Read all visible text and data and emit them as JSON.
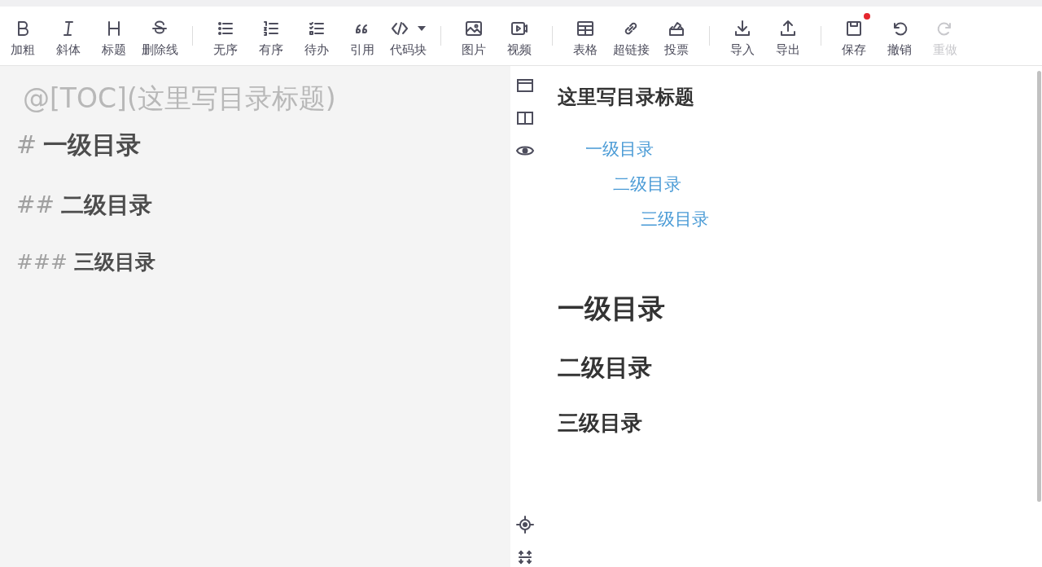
{
  "toolbar": {
    "groups": [
      [
        {
          "kind": "bold",
          "label": "加粗",
          "disabled": false,
          "badge": false
        },
        {
          "kind": "italic",
          "label": "斜体",
          "disabled": false,
          "badge": false
        },
        {
          "kind": "heading",
          "label": "标题",
          "disabled": false,
          "badge": false
        },
        {
          "kind": "strike",
          "label": "删除线",
          "disabled": false,
          "badge": false
        }
      ],
      [
        {
          "kind": "ul",
          "label": "无序",
          "disabled": false,
          "badge": false
        },
        {
          "kind": "ol",
          "label": "有序",
          "disabled": false,
          "badge": false
        },
        {
          "kind": "todo",
          "label": "待办",
          "disabled": false,
          "badge": false
        },
        {
          "kind": "quote",
          "label": "引用",
          "disabled": false,
          "badge": false
        },
        {
          "kind": "code",
          "label": "代码块",
          "disabled": false,
          "badge": false
        }
      ],
      [
        {
          "kind": "image",
          "label": "图片",
          "disabled": false,
          "badge": false
        },
        {
          "kind": "video",
          "label": "视频",
          "disabled": false,
          "badge": false
        }
      ],
      [
        {
          "kind": "table",
          "label": "表格",
          "disabled": false,
          "badge": false
        },
        {
          "kind": "link",
          "label": "超链接",
          "disabled": false,
          "badge": false
        },
        {
          "kind": "vote",
          "label": "投票",
          "disabled": false,
          "badge": false
        }
      ],
      [
        {
          "kind": "import",
          "label": "导入",
          "disabled": false,
          "badge": false
        },
        {
          "kind": "export",
          "label": "导出",
          "disabled": false,
          "badge": false
        }
      ],
      [
        {
          "kind": "save",
          "label": "保存",
          "disabled": false,
          "badge": true
        },
        {
          "kind": "undo",
          "label": "撤销",
          "disabled": false,
          "badge": false
        },
        {
          "kind": "redo",
          "label": "重做",
          "disabled": true,
          "badge": false
        }
      ]
    ]
  },
  "editor": {
    "lines": [
      {
        "kind": "toc",
        "text": "@[TOC](这里写目录标题)"
      },
      {
        "kind": "h1",
        "marker": "#",
        "text": "一级目录"
      },
      {
        "kind": "h2",
        "marker": "##",
        "text": "二级目录"
      },
      {
        "kind": "h3",
        "marker": "###",
        "text": "三级目录"
      }
    ]
  },
  "preview": {
    "toc_title": "这里写目录标题",
    "toc": [
      {
        "text": "一级目录",
        "children": [
          {
            "text": "二级目录",
            "children": [
              {
                "text": "三级目录"
              }
            ]
          }
        ]
      }
    ],
    "headings": [
      {
        "kind": "h1",
        "text": "一级目录"
      },
      {
        "kind": "h2",
        "text": "二级目录"
      },
      {
        "kind": "h3",
        "text": "三级目录"
      }
    ]
  }
}
